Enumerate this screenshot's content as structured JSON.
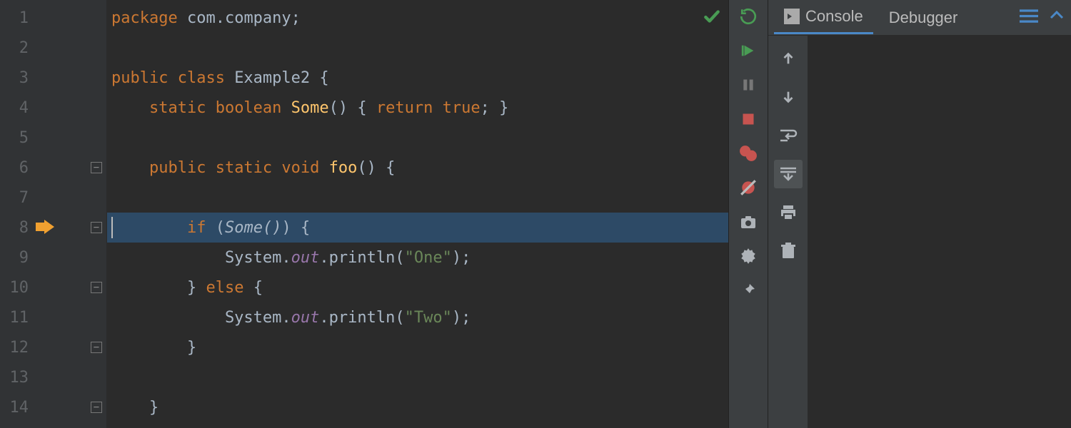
{
  "editor": {
    "lines": [
      {
        "n": 1,
        "tokens": [
          [
            "kw",
            "package "
          ],
          [
            "dim",
            "com.company"
          ],
          [
            "pun",
            ";"
          ]
        ]
      },
      {
        "n": 2,
        "tokens": []
      },
      {
        "n": 3,
        "tokens": [
          [
            "kw",
            "public class "
          ],
          [
            "cls",
            "Example2 "
          ],
          [
            "pun",
            "{"
          ]
        ]
      },
      {
        "n": 4,
        "tokens": [
          [
            "dim",
            "    "
          ],
          [
            "kw",
            "static boolean "
          ],
          [
            "fn",
            "Some"
          ],
          [
            "pun",
            "() { "
          ],
          [
            "kw",
            "return true"
          ],
          [
            "pun",
            "; }"
          ]
        ]
      },
      {
        "n": 5,
        "tokens": []
      },
      {
        "n": 6,
        "tokens": [
          [
            "dim",
            "    "
          ],
          [
            "kw",
            "public static void "
          ],
          [
            "fn",
            "foo"
          ],
          [
            "pun",
            "() {"
          ]
        ],
        "fold": true
      },
      {
        "n": 7,
        "tokens": []
      },
      {
        "n": 8,
        "tokens": [
          [
            "dim",
            "        "
          ],
          [
            "kw",
            "if "
          ],
          [
            "pun",
            "("
          ],
          [
            "call-it",
            "Some()"
          ],
          [
            "pun",
            ") {"
          ]
        ],
        "current": true,
        "execPointer": true,
        "fold": true
      },
      {
        "n": 9,
        "tokens": [
          [
            "dim",
            "            System."
          ],
          [
            "out",
            "out"
          ],
          [
            "dim",
            ".println("
          ],
          [
            "str",
            "\"One\""
          ],
          [
            "pun",
            ");"
          ]
        ]
      },
      {
        "n": 10,
        "tokens": [
          [
            "dim",
            "        "
          ],
          [
            "pun",
            "} "
          ],
          [
            "kw",
            "else "
          ],
          [
            "pun",
            "{"
          ]
        ],
        "fold": true
      },
      {
        "n": 11,
        "tokens": [
          [
            "dim",
            "            System."
          ],
          [
            "out",
            "out"
          ],
          [
            "dim",
            ".println("
          ],
          [
            "str",
            "\"Two\""
          ],
          [
            "pun",
            ");"
          ]
        ]
      },
      {
        "n": 12,
        "tokens": [
          [
            "dim",
            "        "
          ],
          [
            "pun",
            "}"
          ]
        ],
        "fold": true
      },
      {
        "n": 13,
        "tokens": []
      },
      {
        "n": 14,
        "tokens": [
          [
            "dim",
            "    "
          ],
          [
            "pun",
            "}"
          ]
        ],
        "fold": true
      }
    ],
    "inspection_ok_icon": "check"
  },
  "run_toolbar": {
    "items": [
      "rerun",
      "resume",
      "pause",
      "stop",
      "view-breakpoints",
      "mute-breakpoints",
      "camera",
      "settings",
      "pin"
    ]
  },
  "panel": {
    "tabs": [
      {
        "label": "Console",
        "icon": "terminal",
        "active": true
      },
      {
        "label": "Debugger",
        "active": false
      }
    ],
    "tabbar_icons": [
      "layout",
      "restore"
    ],
    "vtoolbar": [
      "up",
      "down",
      "wrap",
      "scroll-to-end",
      "print",
      "clear"
    ],
    "vtoolbar_active_index": 3
  },
  "colors": {
    "keyword": "#cc7832",
    "function": "#ffc66d",
    "string": "#6a8759",
    "field": "#9876aa",
    "gutter_bg": "#313335",
    "editor_bg": "#2b2b2b",
    "current_line": "#2d4a66",
    "accent": "#4a88c7"
  }
}
